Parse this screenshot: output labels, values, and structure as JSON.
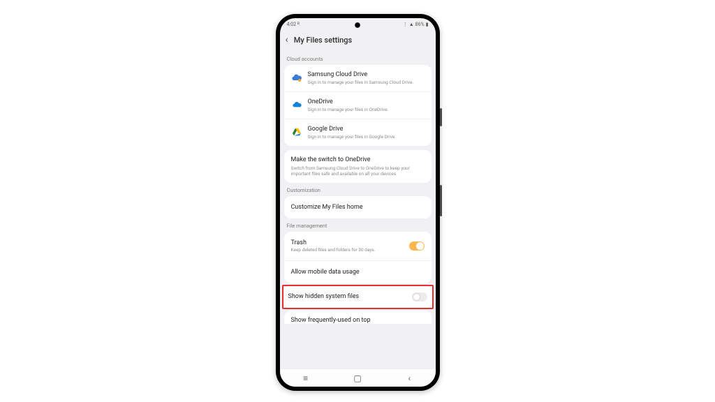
{
  "status": {
    "time": "4:02",
    "time_suffix": "ᴿ",
    "battery_pct": "86%",
    "battery_icon": "▮"
  },
  "header": {
    "title": "My Files settings"
  },
  "sections": {
    "cloud_header": "Cloud accounts",
    "cloud": [
      {
        "title": "Samsung Cloud Drive",
        "sub": "Sign in to manage your files in Samsung Cloud Drive."
      },
      {
        "title": "OneDrive",
        "sub": "Sign in to manage your files in OneDrive."
      },
      {
        "title": "Google Drive",
        "sub": "Sign in to manage your files in Google Drive."
      }
    ],
    "onedrive_promo": {
      "title": "Make the switch to OneDrive",
      "sub": "Switch from Samsung Cloud Drive to OneDrive to keep your important files safe and available on all your devices."
    },
    "customization_header": "Customization",
    "customize_label": "Customize My Files home",
    "filemgmt_header": "File management",
    "trash": {
      "title": "Trash",
      "sub": "Keep deleted files and folders for 30 days."
    },
    "allow_data": "Allow mobile data usage",
    "show_hidden": "Show hidden system files",
    "show_freq": "Show frequently-used on top"
  },
  "colors": {
    "highlight": "#e53030",
    "toggle_on": "#ffb74d"
  }
}
